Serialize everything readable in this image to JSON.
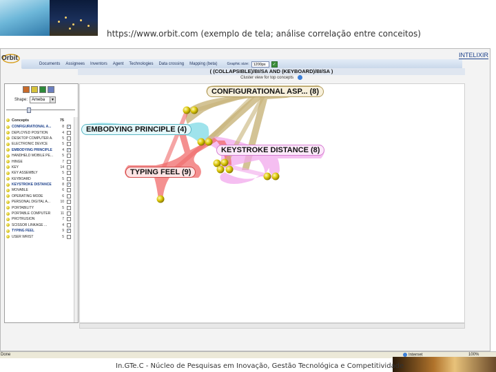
{
  "slide": {
    "url_caption": "https://www.orbit.com (exemplo de tela; análise correlação entre conceitos)",
    "footer": "In.GTe.C - Núcleo de Pesquisas em Inovação, Gestão Tecnológica e Competitividade"
  },
  "app": {
    "logo": "Orbit",
    "brand": "INTELIXIR",
    "menu": [
      "Documents",
      "Assignees",
      "Inventors",
      "Agent",
      "Technologies",
      "Data crossing",
      "Mapping (beta)"
    ],
    "graphic_size_label": "Graphic size:",
    "graphic_size_value": "1200px",
    "query": "( (COLLAPSIBLE)/BI/SA AND (KEYBOARD)/BI/SA )",
    "cluster_label": "Cluster view for top concepts",
    "shape_label": "Shape:",
    "shape_value": "Ameba",
    "concept_header": "Concepts",
    "concept_header_count": "75",
    "concepts": [
      {
        "name": "CONFIGURATIONAL A...",
        "count": "8",
        "checked": "✓",
        "selected": true
      },
      {
        "name": "DEPLOYED POSITION",
        "count": "4",
        "checked": "",
        "selected": false
      },
      {
        "name": "DESKTOP COMPUTER A...",
        "count": "5",
        "checked": "",
        "selected": false
      },
      {
        "name": "ELECTRONIC DEVICE",
        "count": "5",
        "checked": "",
        "selected": false
      },
      {
        "name": "EMBODYING PRINCIPLE",
        "count": "4",
        "checked": "✓",
        "selected": true
      },
      {
        "name": "HANDHELD MOBILE PE...",
        "count": "5",
        "checked": "",
        "selected": false
      },
      {
        "name": "HINGE",
        "count": "7",
        "checked": "",
        "selected": false
      },
      {
        "name": "KEY",
        "count": "14",
        "checked": "",
        "selected": false
      },
      {
        "name": "KEY ASSEMBLY",
        "count": "5",
        "checked": "",
        "selected": false
      },
      {
        "name": "KEYBOARD",
        "count": "5",
        "checked": "",
        "selected": false
      },
      {
        "name": "KEYSTROKE DISTANCE",
        "count": "8",
        "checked": "✓",
        "selected": true
      },
      {
        "name": "MOVABLE",
        "count": "6",
        "checked": "",
        "selected": false
      },
      {
        "name": "OPERATING MODE",
        "count": "6",
        "checked": "",
        "selected": false
      },
      {
        "name": "PERSONAL DIGITAL A...",
        "count": "10",
        "checked": "",
        "selected": false
      },
      {
        "name": "PORTABILITY",
        "count": "5",
        "checked": "",
        "selected": false
      },
      {
        "name": "PORTABLE COMPUTER",
        "count": "11",
        "checked": "",
        "selected": false
      },
      {
        "name": "PROTRUSION",
        "count": "7",
        "checked": "",
        "selected": false
      },
      {
        "name": "SCISSOR LINKAGE ...",
        "count": "4",
        "checked": "",
        "selected": false
      },
      {
        "name": "TYPING FEEL",
        "count": "9",
        "checked": "✓",
        "selected": true
      },
      {
        "name": "USER WRIST",
        "count": "5",
        "checked": "",
        "selected": false
      }
    ],
    "graph_nodes": [
      {
        "label": "CONFIGURATIONAL ASP...",
        "count": "(8)",
        "color": "#c8b47a"
      },
      {
        "label": "EMBODYING PRINCIPLE",
        "count": "(4)",
        "color": "#7fd9e6"
      },
      {
        "label": "KEYSTROKE DISTANCE",
        "count": "(8)",
        "color": "#f2a8ec"
      },
      {
        "label": "TYPING FEEL",
        "count": "(9)",
        "color": "#f06b6b"
      }
    ],
    "status": {
      "left": "Done",
      "zone": "Internet",
      "zoom": "100%"
    }
  }
}
